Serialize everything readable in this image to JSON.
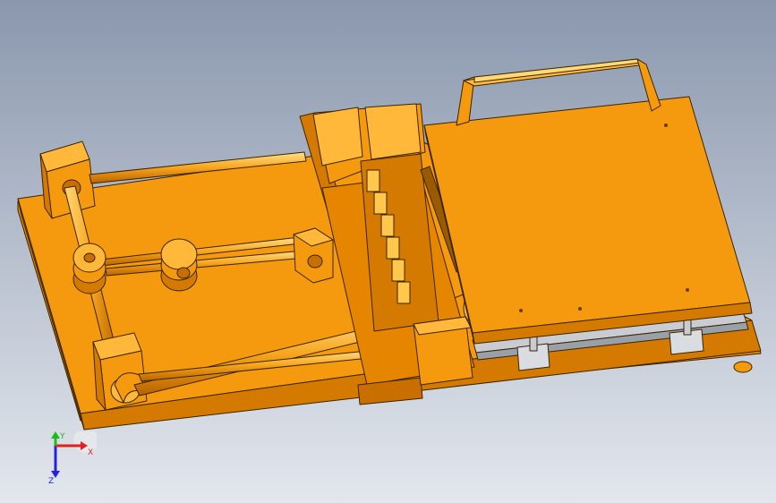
{
  "viewport": {
    "background_top": "#8a97ad",
    "background_bottom": "#e3e7ed"
  },
  "model": {
    "body_color": "#f59a0f",
    "light_color": "#ffb83a",
    "dark_color": "#c86f00",
    "edge_color": "#3a2400",
    "rail_color": "#c9ccd2"
  },
  "triad": {
    "x_label": "X",
    "y_label": "Y",
    "z_label": "Z",
    "x_color": "#e0221c",
    "y_color": "#1fb81f",
    "z_color": "#2323d8"
  }
}
